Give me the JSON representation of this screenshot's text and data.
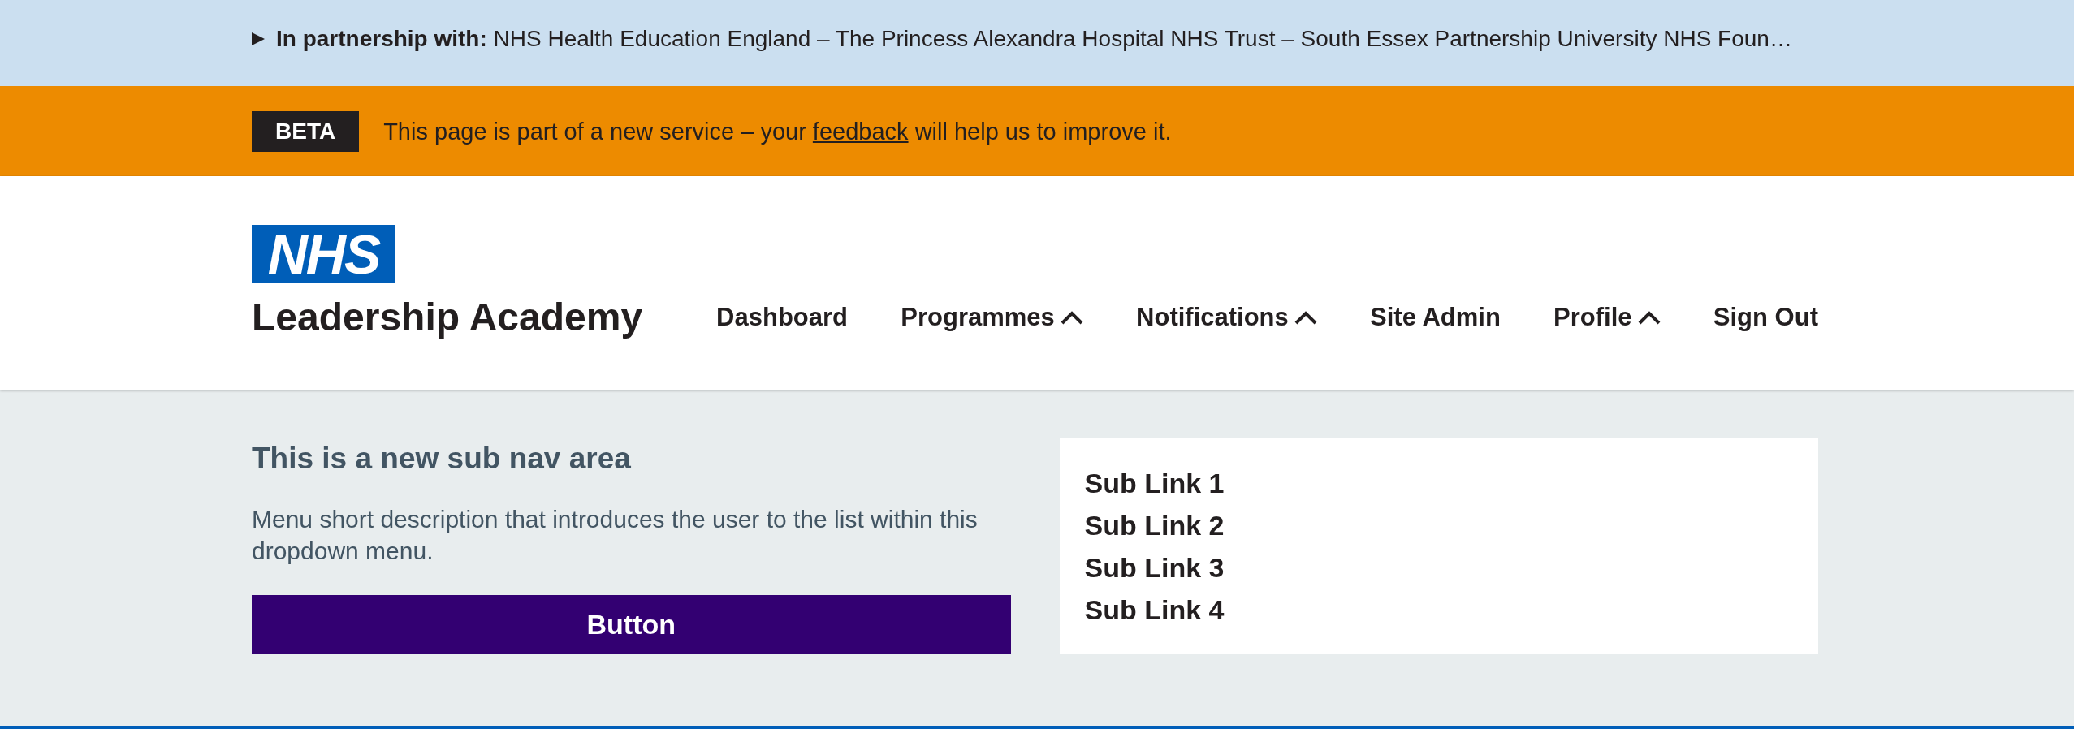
{
  "partnership_bar": {
    "expanded": false,
    "text": "**In partnership with:** NHS Health Education England – The Princess Alexandra Hospital NHS Trust – South Essex Partnership University NHS Foun…"
  },
  "phase_banner": {
    "tag": "BETA",
    "text_before": "This page is part of a new service – your",
    "link": "feedback",
    "text_after": "will help us to improve it."
  },
  "header": {
    "logo": "NHS",
    "service_name": "Leadership Academy",
    "nav": [
      {
        "label": "Dashboard",
        "kind": "link"
      },
      {
        "label": "Programmes",
        "kind": "dropdown"
      },
      {
        "label": "Notifications",
        "kind": "dropdown"
      },
      {
        "label": "Site Admin",
        "kind": "link"
      },
      {
        "label": "Profile",
        "kind": "dropdown"
      },
      {
        "label": "Sign Out",
        "kind": "link"
      }
    ]
  },
  "sub_nav": {
    "title": "This is a new sub nav area",
    "description": "Menu short description that introduces the user to the list within this dropdown menu.",
    "button": "Button",
    "links": [
      "Sub Link 1",
      "Sub Link 2",
      "Sub Link 3",
      "Sub Link 4"
    ]
  }
}
